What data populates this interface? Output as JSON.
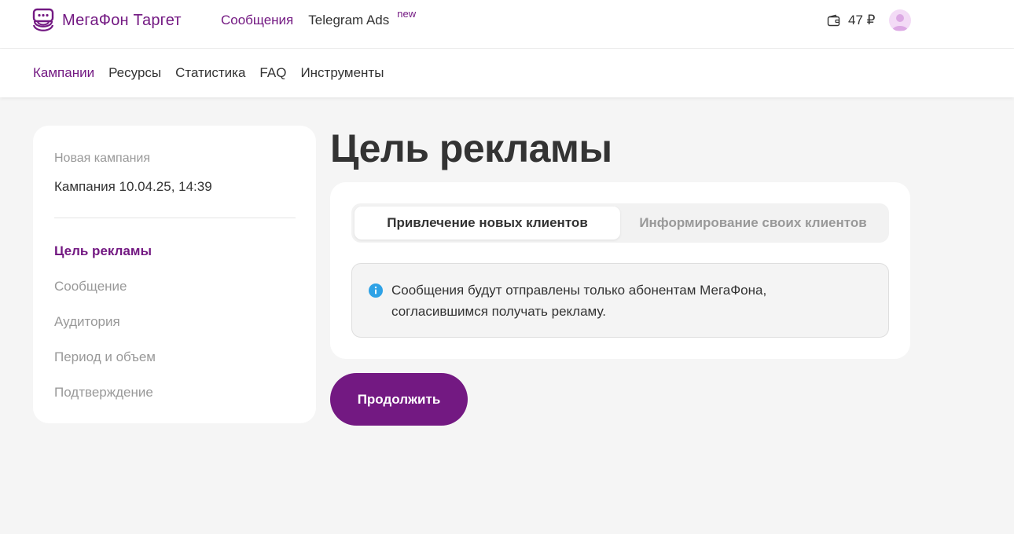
{
  "header": {
    "logo_text": "МегаФон Таргет",
    "nav": {
      "messages": "Сообщения",
      "telegram_ads": "Telegram Ads",
      "badge_new": "new"
    },
    "balance": "47 ₽",
    "icons": {
      "logo": "megafon-logo-icon",
      "wallet": "wallet-icon",
      "avatar": "user-avatar-icon"
    },
    "colors": {
      "brand": "#731982",
      "avatar_bg": "#f3dbf6"
    }
  },
  "subnav": {
    "items": [
      {
        "label": "Кампании",
        "active": true
      },
      {
        "label": "Ресурсы",
        "active": false
      },
      {
        "label": "Статистика",
        "active": false
      },
      {
        "label": "FAQ",
        "active": false
      },
      {
        "label": "Инструменты",
        "active": false
      }
    ]
  },
  "sidebar": {
    "caption": "Новая кампания",
    "campaign_name": "Кампания 10.04.25, 14:39",
    "steps": [
      {
        "label": "Цель рекламы",
        "active": true
      },
      {
        "label": "Сообщение",
        "active": false
      },
      {
        "label": "Аудитория",
        "active": false
      },
      {
        "label": "Период и объем",
        "active": false
      },
      {
        "label": "Подтверждение",
        "active": false
      }
    ]
  },
  "main": {
    "title": "Цель рекламы",
    "tabs": [
      {
        "label": "Привлечение новых клиентов",
        "selected": true
      },
      {
        "label": "Информирование своих клиентов",
        "selected": false
      }
    ],
    "info": {
      "icon": "info-icon",
      "text": "Сообщения будут отправлены только абонентам МегаФона, согласившимся получать рекламу.",
      "icon_color": "#2ea2e6"
    },
    "continue_label": "Продолжить"
  }
}
